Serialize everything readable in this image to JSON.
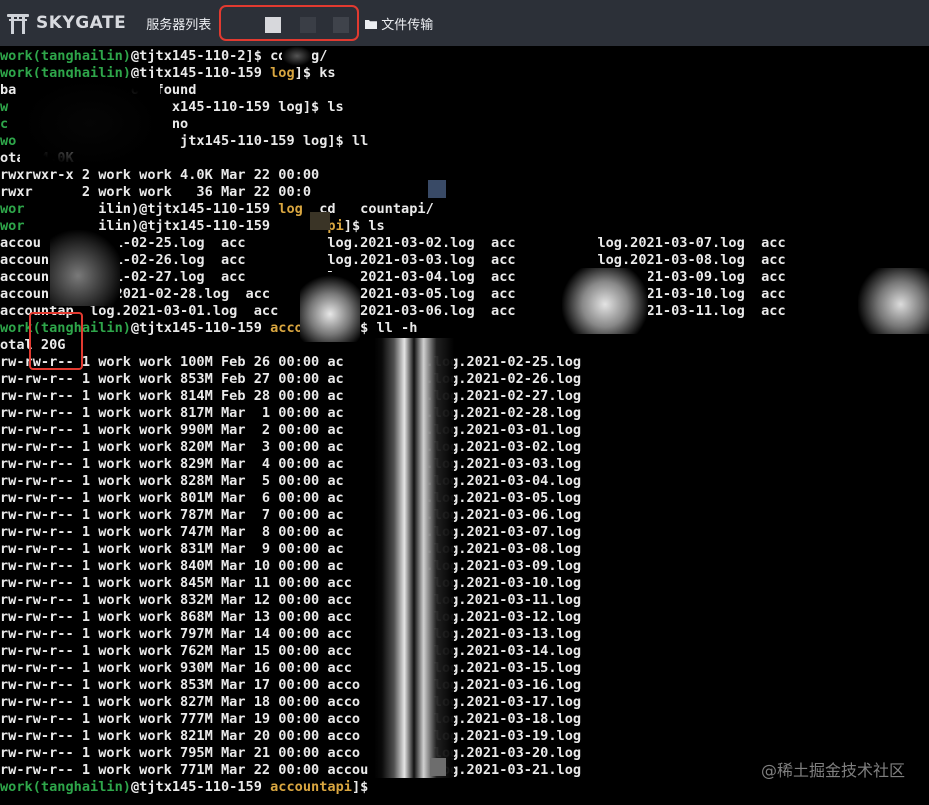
{
  "topbar": {
    "brand": "SKYGATE",
    "server_list_label": "服务器列表",
    "file_transfer_label": "文件传输"
  },
  "terminal": {
    "lines": [
      {
        "user": "work(tanghailin)",
        "host": "@tjtx145-110-",
        "dir": "",
        "rest": "2]$ cd log/"
      },
      {
        "user": "work(tanghailin)",
        "host": "@tjtx145-110-159 ",
        "dir": "log",
        "rest": "]$ ks"
      },
      {
        "user": "",
        "host": "ba",
        "dir": "",
        "rest": "              ot found"
      },
      {
        "user": "w",
        "host": "",
        "dir": "",
        "rest": "                    x145-110-159 log]$ ls"
      },
      {
        "user": "c",
        "host": "",
        "dir": "",
        "rest": "                    no"
      },
      {
        "user": "wo",
        "host": "",
        "dir": "",
        "rest": "                    jtx145-110-159 log]$ ll"
      },
      {
        "user": "",
        "host": "otal 4.0K",
        "dir": "",
        "rest": ""
      },
      {
        "user": "",
        "host": "rwxrwxr-x 2 work work 4.0K Mar 22 00:00",
        "dir": "",
        "rest": ""
      },
      {
        "user": "",
        "host": "rwxr      2 work work   36 Mar 22 00:0",
        "dir": "",
        "rest": ""
      },
      {
        "user": "wor",
        "host": "         ilin)@tjtx145-110-159 ",
        "dir": "log",
        "rest": "  cd   countapi/"
      },
      {
        "user": "wor",
        "host": "         ilin)@tjtx145-110-159 ",
        "dir": "     api",
        "rest": "]$ ls"
      },
      {
        "user": "",
        "host": "accou    g.2021-02-25.log  acc          log.2021-03-02.log  acc          log.2021-03-07.log  acc",
        "dir": "",
        "rest": ""
      },
      {
        "user": "",
        "host": "accoun    .2021-02-26.log  acc          log.2021-03-03.log  acc          log.2021-03-08.log  acc",
        "dir": "",
        "rest": ""
      },
      {
        "user": "",
        "host": "accoun    .2021-02-27.log  acc          log.2021-03-04.log  acc          log.2021-03-09.log  acc",
        "dir": "",
        "rest": ""
      },
      {
        "user": "",
        "host": "accoun    log.2021-02-28.log  acc       log.2021-03-05.log  acc          log.2021-03-10.log  acc",
        "dir": "",
        "rest": ""
      },
      {
        "user": "",
        "host": "accountap  log.2021-03-01.log  acc      log.2021-03-06.log  acc          log.2021-03-11.log  acc",
        "dir": "",
        "rest": ""
      },
      {
        "user": "work(tanghailin)",
        "host": "@tjtx145-110-159 ",
        "dir": "accountapi",
        "rest": "]$ ll -h"
      },
      {
        "user": "",
        "host": "otal 20G",
        "dir": "",
        "rest": ""
      },
      {
        "user": "",
        "host": "rw-rw-r-- 1 work work 100M Feb 26 00:00 ac          .log.2021-02-25.log",
        "dir": "",
        "rest": ""
      },
      {
        "user": "",
        "host": "rw-rw-r-- 1 work work 853M Feb 27 00:00 ac          .log.2021-02-26.log",
        "dir": "",
        "rest": ""
      },
      {
        "user": "",
        "host": "rw-rw-r-- 1 work work 814M Feb 28 00:00 ac          .log.2021-02-27.log",
        "dir": "",
        "rest": ""
      },
      {
        "user": "",
        "host": "rw-rw-r-- 1 work work 817M Mar  1 00:00 ac          .log.2021-02-28.log",
        "dir": "",
        "rest": ""
      },
      {
        "user": "",
        "host": "rw-rw-r-- 1 work work 990M Mar  2 00:00 ac          .log.2021-03-01.log",
        "dir": "",
        "rest": ""
      },
      {
        "user": "",
        "host": "rw-rw-r-- 1 work work 820M Mar  3 00:00 ac          .log.2021-03-02.log",
        "dir": "",
        "rest": ""
      },
      {
        "user": "",
        "host": "rw-rw-r-- 1 work work 829M Mar  4 00:00 ac          .log.2021-03-03.log",
        "dir": "",
        "rest": ""
      },
      {
        "user": "",
        "host": "rw-rw-r-- 1 work work 828M Mar  5 00:00 ac          .log.2021-03-04.log",
        "dir": "",
        "rest": ""
      },
      {
        "user": "",
        "host": "rw-rw-r-- 1 work work 801M Mar  6 00:00 ac          .log.2021-03-05.log",
        "dir": "",
        "rest": ""
      },
      {
        "user": "",
        "host": "rw-rw-r-- 1 work work 787M Mar  7 00:00 ac          .log.2021-03-06.log",
        "dir": "",
        "rest": ""
      },
      {
        "user": "",
        "host": "rw-rw-r-- 1 work work 747M Mar  8 00:00 ac          .log.2021-03-07.log",
        "dir": "",
        "rest": ""
      },
      {
        "user": "",
        "host": "rw-rw-r-- 1 work work 831M Mar  9 00:00 ac          .log.2021-03-08.log",
        "dir": "",
        "rest": ""
      },
      {
        "user": "",
        "host": "rw-rw-r-- 1 work work 840M Mar 10 00:00 ac          .log.2021-03-09.log",
        "dir": "",
        "rest": ""
      },
      {
        "user": "",
        "host": "rw-rw-r-- 1 work work 845M Mar 11 00:00 acc          log.2021-03-10.log",
        "dir": "",
        "rest": ""
      },
      {
        "user": "",
        "host": "rw-rw-r-- 1 work work 832M Mar 12 00:00 acc          log.2021-03-11.log",
        "dir": "",
        "rest": ""
      },
      {
        "user": "",
        "host": "rw-rw-r-- 1 work work 868M Mar 13 00:00 acc          log.2021-03-12.log",
        "dir": "",
        "rest": ""
      },
      {
        "user": "",
        "host": "rw-rw-r-- 1 work work 797M Mar 14 00:00 acc          log.2021-03-13.log",
        "dir": "",
        "rest": ""
      },
      {
        "user": "",
        "host": "rw-rw-r-- 1 work work 762M Mar 15 00:00 acc          log.2021-03-14.log",
        "dir": "",
        "rest": ""
      },
      {
        "user": "",
        "host": "rw-rw-r-- 1 work work 930M Mar 16 00:00 acc          log.2021-03-15.log",
        "dir": "",
        "rest": ""
      },
      {
        "user": "",
        "host": "rw-rw-r-- 1 work work 853M Mar 17 00:00 acco         log.2021-03-16.log",
        "dir": "",
        "rest": ""
      },
      {
        "user": "",
        "host": "rw-rw-r-- 1 work work 827M Mar 18 00:00 acco         log.2021-03-17.log",
        "dir": "",
        "rest": ""
      },
      {
        "user": "",
        "host": "rw-rw-r-- 1 work work 777M Mar 19 00:00 acco         log.2021-03-18.log",
        "dir": "",
        "rest": ""
      },
      {
        "user": "",
        "host": "rw-rw-r-- 1 work work 821M Mar 20 00:00 acco         log.2021-03-19.log",
        "dir": "",
        "rest": ""
      },
      {
        "user": "",
        "host": "rw-rw-r-- 1 work work 795M Mar 21 00:00 acco         log.2021-03-20.log",
        "dir": "",
        "rest": ""
      },
      {
        "user": "",
        "host": "rw-rw-r-- 1 work work 771M Mar 22 00:00 accou        log.2021-03-21.log",
        "dir": "",
        "rest": ""
      },
      {
        "user": "work(tanghailin)",
        "host": "@tjtx145-110-159 ",
        "dir": "accountapi",
        "rest": "]$"
      }
    ]
  },
  "watermark": "@稀土掘金技术社区",
  "colors": {
    "topbar_bg": "#2c3038",
    "terminal_bg": "#000000",
    "prompt_user": "#2ea64a",
    "prompt_dir": "#d9a640",
    "text": "#eaeaea",
    "highlight": "#e23a30"
  }
}
